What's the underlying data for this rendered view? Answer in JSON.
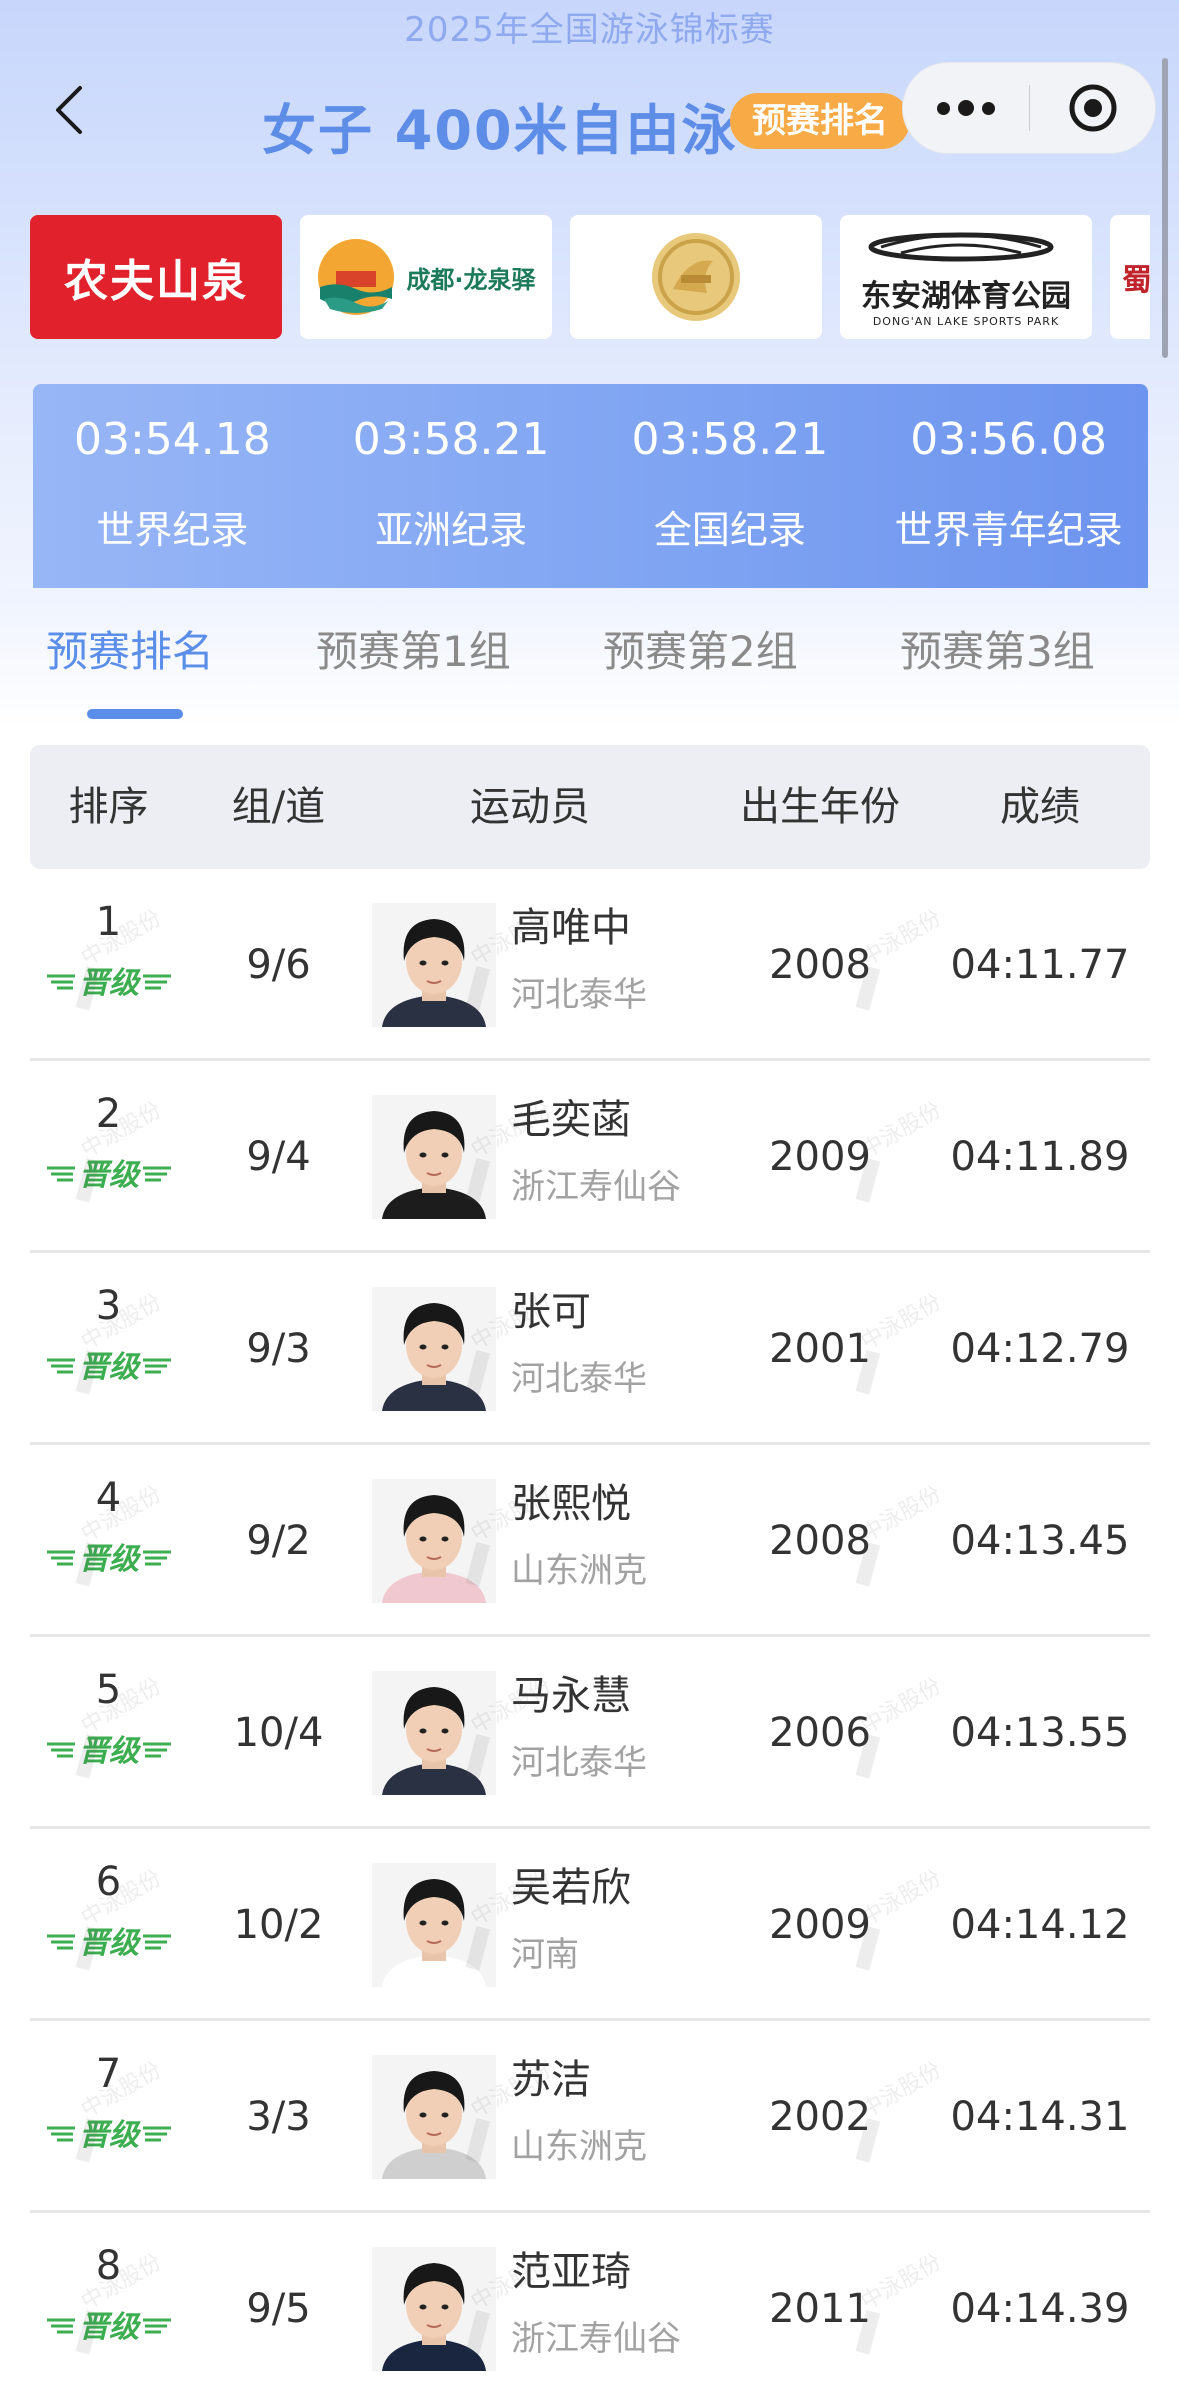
{
  "header": {
    "event_name": "2025年全国游泳锦标赛",
    "title": "女子 400米自由泳",
    "badge": "预赛排名"
  },
  "sponsors": [
    {
      "name": "农夫山泉"
    },
    {
      "name": "成都·龙泉驿"
    },
    {
      "name": ""
    },
    {
      "name": "东安湖体育公园",
      "subtitle": "DONG'AN LAKE SPORTS PARK"
    },
    {
      "name": "蜀"
    }
  ],
  "records": [
    {
      "time": "03:54.18",
      "label": "世界纪录"
    },
    {
      "time": "03:58.21",
      "label": "亚洲纪录"
    },
    {
      "time": "03:58.21",
      "label": "全国纪录"
    },
    {
      "time": "03:56.08",
      "label": "世界青年纪录"
    }
  ],
  "tabs": [
    "预赛排名",
    "预赛第1组",
    "预赛第2组",
    "预赛第3组"
  ],
  "active_tab": 0,
  "table": {
    "headers": [
      "排序",
      "组/道",
      "运动员",
      "出生年份",
      "成绩"
    ],
    "qualified_label": "晋级",
    "rows": [
      {
        "rank": "1",
        "lane": "9/6",
        "name": "高唯中",
        "team": "河北泰华",
        "year": "2008",
        "time": "04:11.77"
      },
      {
        "rank": "2",
        "lane": "9/4",
        "name": "毛奕菡",
        "team": "浙江寿仙谷",
        "year": "2009",
        "time": "04:11.89"
      },
      {
        "rank": "3",
        "lane": "9/3",
        "name": "张可",
        "team": "河北泰华",
        "year": "2001",
        "time": "04:12.79"
      },
      {
        "rank": "4",
        "lane": "9/2",
        "name": "张熙悦",
        "team": "山东洲克",
        "year": "2008",
        "time": "04:13.45"
      },
      {
        "rank": "5",
        "lane": "10/4",
        "name": "马永慧",
        "team": "河北泰华",
        "year": "2006",
        "time": "04:13.55"
      },
      {
        "rank": "6",
        "lane": "10/2",
        "name": "吴若欣",
        "team": "河南",
        "year": "2009",
        "time": "04:14.12"
      },
      {
        "rank": "7",
        "lane": "3/3",
        "name": "苏洁",
        "team": "山东洲克",
        "year": "2002",
        "time": "04:14.31"
      },
      {
        "rank": "8",
        "lane": "9/5",
        "name": "范亚琦",
        "team": "浙江寿仙谷",
        "year": "2011",
        "time": "04:14.39"
      }
    ]
  },
  "watermark": "中泳股份",
  "colors": {
    "accent": "#5b8ee8",
    "badge": "#f7aa45",
    "qualified": "#3cae4f",
    "records_bg": "#7ea3f2",
    "sponsor_red": "#e1212b"
  },
  "icons": {
    "back": "chevron-left-icon",
    "more": "more-dots-icon",
    "close": "target-circle-icon",
    "qualified": "wing-badge-icon"
  }
}
